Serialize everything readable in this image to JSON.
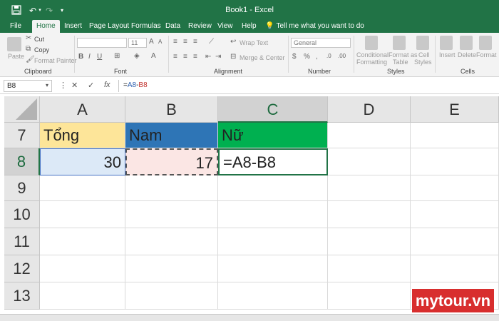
{
  "window": {
    "title": "Book1  -  Excel"
  },
  "quick_access": {
    "save_icon": "save-icon",
    "undo_icon": "undo-icon",
    "redo_icon": "redo-icon",
    "customize_icon": "customize-icon"
  },
  "tabs": [
    "File",
    "Home",
    "Insert",
    "Page Layout",
    "Formulas",
    "Data",
    "Review",
    "View",
    "Help"
  ],
  "active_tab": "Home",
  "tell_me": "Tell me what you want to do",
  "ribbon": {
    "clipboard": {
      "paste": "Paste",
      "cut": "Cut",
      "copy": "Copy",
      "format_painter": "Format Painter",
      "label": "Clipboard"
    },
    "font": {
      "size": "11",
      "label": "Font"
    },
    "alignment": {
      "wrap_text": "Wrap Text",
      "merge_center": "Merge & Center",
      "label": "Alignment"
    },
    "number": {
      "format": "General",
      "label": "Number"
    },
    "styles": {
      "conditional": "Conditional",
      "formatting": "Formatting",
      "format_as": "Format as",
      "table": "Table",
      "cell": "Cell",
      "styles_btn": "Styles",
      "label": "Styles"
    },
    "cells": {
      "insert": "Insert",
      "delete": "Delete",
      "format": "Format",
      "label": "Cells"
    }
  },
  "formula_bar": {
    "name_box": "B8",
    "cancel_icon": "✕",
    "enter_icon": "✓",
    "fx": "fx",
    "formula_eq": "=",
    "formula_a": "A8",
    "formula_minus": "-",
    "formula_b": "B8"
  },
  "grid": {
    "columns": [
      "A",
      "B",
      "C",
      "D",
      "E"
    ],
    "rows": [
      "7",
      "8",
      "9",
      "10",
      "11",
      "12",
      "13"
    ],
    "cells": {
      "A7": "Tổng",
      "B7": "Nam",
      "C7": "Nữ",
      "A8": "30",
      "B8": "17",
      "C8": "=A8-B8"
    },
    "colors": {
      "A7": "#fde599",
      "B7": "#2e75b6",
      "C7": "#00b050",
      "A8": "#dce9f7",
      "B8": "#fbe6e4"
    }
  },
  "watermark": "mytour.vn"
}
